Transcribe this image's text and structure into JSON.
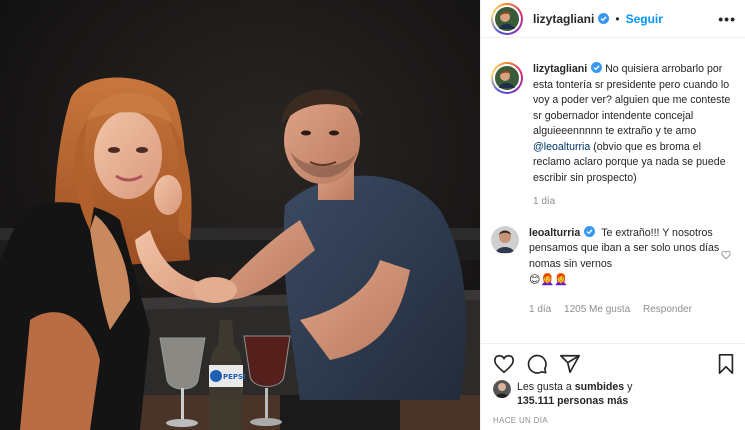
{
  "post": {
    "username": "lizytagliani",
    "follow_label": "Seguir",
    "more_label": "•••",
    "separator": "•"
  },
  "caption": {
    "username": "lizytagliani",
    "text_before_mention": "No quisiera arrobarlo por esta tontería sr presidente pero cuando lo voy a poder ver? alguien que me conteste sr gobernador intendente concejal alguieeennnnn te extraño y te amo ",
    "mention": "@leoalturria",
    "text_after_mention": " (obvio que es broma el reclamo aclaro porque ya nada se puede escribir sin prospecto)",
    "time": "1 día"
  },
  "comment": {
    "username": "leoalturria",
    "text": "Te extraño!!! Y nosotros pensamos que iban a ser solo unos días nomas sin vernos",
    "emojis": "😊👩‍🦰👩‍🦰",
    "time": "1 día",
    "likes": "1205 Me gusta",
    "reply_label": "Responder"
  },
  "likes": {
    "prefix": "Les gusta a ",
    "user": "sumbides",
    "connector": " y",
    "others": "135.111 personas más"
  },
  "timestamp": "HACE UN DÍA",
  "photo": {
    "bottle_label": "PEPSI"
  },
  "colors": {
    "accent": "#0095f6",
    "text": "#262626",
    "muted": "#8e8e8e"
  },
  "icons": [
    "verified-badge-icon",
    "heart-icon",
    "comment-icon",
    "share-icon",
    "bookmark-icon",
    "more-icon"
  ]
}
